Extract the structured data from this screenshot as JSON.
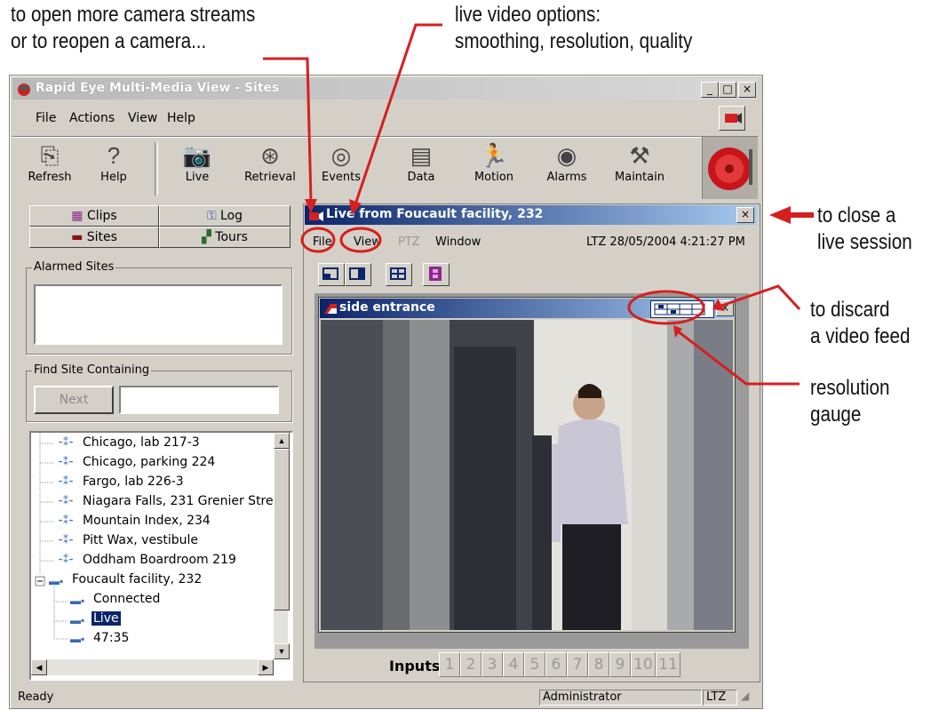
{
  "annotations": {
    "top_left": "to open more camera streams\nor to reopen a camera...",
    "top_right": "live video options:\nsmoothing, resolution, quality",
    "close_session": "to close a\nlive session",
    "discard_feed": "to discard\na video feed",
    "resolution_gauge": "resolution\ngauge"
  },
  "window": {
    "title": "Rapid Eye Multi-Media View - Sites",
    "menu": [
      "File",
      "Actions",
      "View",
      "Help"
    ],
    "controls": [
      "_",
      "□",
      "×"
    ]
  },
  "toolbar": [
    {
      "label": "Refresh",
      "icon": "refresh-icon"
    },
    {
      "label": "Help",
      "icon": "help-icon"
    },
    {
      "label": "Live",
      "icon": "camera-icon"
    },
    {
      "label": "Retrieval",
      "icon": "retrieval-icon"
    },
    {
      "label": "Events",
      "icon": "events-icon"
    },
    {
      "label": "Data",
      "icon": "data-icon"
    },
    {
      "label": "Motion",
      "icon": "motion-icon"
    },
    {
      "label": "Alarms",
      "icon": "alarms-icon"
    },
    {
      "label": "Maintain",
      "icon": "maintain-icon"
    }
  ],
  "left_panel": {
    "tabs": [
      "Clips",
      "Log",
      "Sites",
      "Tours"
    ],
    "alarmed_sites_label": "Alarmed Sites",
    "find_site_label": "Find Site Containing",
    "next_button": "Next",
    "find_value": "",
    "tree": [
      "Chicago, lab 217-3",
      "Chicago, parking 224",
      "Fargo, lab 226-3",
      "Niagara Falls, 231 Grenier Stre",
      "Mountain Index, 234",
      "Pitt Wax, vestibule",
      "Oddham Boardroom 219",
      "Foucault facility, 232",
      "Connected",
      "Live",
      "47:35"
    ]
  },
  "live_session": {
    "title": "Live from Foucault facility, 232",
    "menu": [
      "File",
      "View",
      "PTZ",
      "Window"
    ],
    "timestamp": "LTZ 28/05/2004 4:21:27 PM",
    "close": "×"
  },
  "video_feed": {
    "title": "side entrance",
    "close": "×"
  },
  "inputs": {
    "label": "Inputs",
    "buttons": [
      "1",
      "2",
      "3",
      "4",
      "5",
      "6",
      "7",
      "8",
      "9",
      "10",
      "11"
    ]
  },
  "status": {
    "ready": "Ready",
    "user": "Administrator",
    "tz": "LTZ"
  },
  "colors": {
    "annotation": "#d61f1f",
    "title_gradient_start": "#0a246a",
    "title_gradient_end": "#a6caf0",
    "window_face": "#d4d0c8"
  }
}
